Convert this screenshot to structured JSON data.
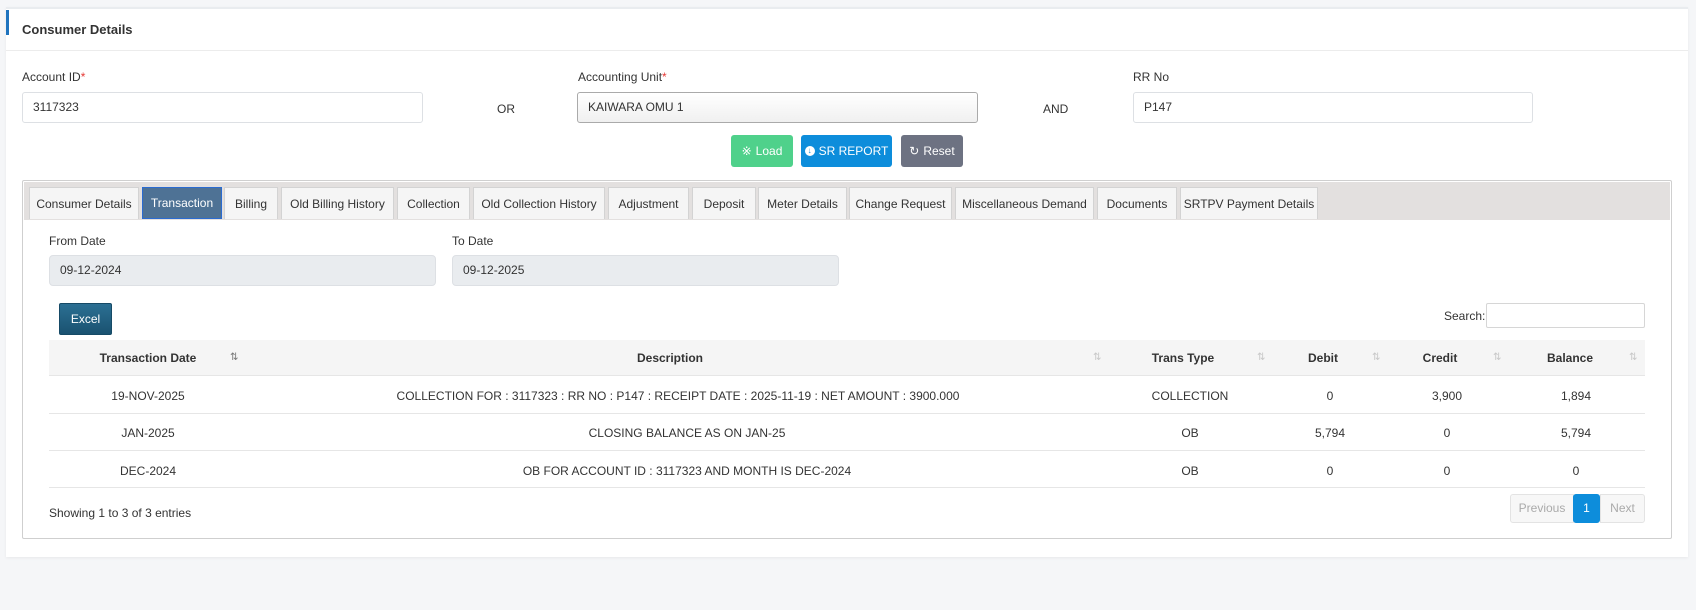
{
  "header": {
    "title": "Consumer Details"
  },
  "form": {
    "account_id_label": "Account ID",
    "account_id_value": "3117323",
    "required_mark": "*",
    "or_label": "OR",
    "accounting_unit_label": "Accounting Unit",
    "accounting_unit_value": "KAIWARA OMU 1",
    "and_label": "AND",
    "rr_no_label": "RR No",
    "rr_no_value": "P147"
  },
  "buttons": {
    "load": "Load",
    "sr_report": "SR REPORT",
    "reset": "Reset"
  },
  "tabs": [
    "Consumer Details",
    "Transaction",
    "Billing",
    "Old Billing History",
    "Collection",
    "Old Collection History",
    "Adjustment",
    "Deposit",
    "Meter Details",
    "Change Request",
    "Miscellaneous Demand",
    "Documents",
    "SRTPV Payment Details"
  ],
  "active_tab": "Transaction",
  "dates": {
    "from_label": "From Date",
    "from_value": "09-12-2024",
    "to_label": "To Date",
    "to_value": "09-12-2025"
  },
  "table": {
    "excel_label": "Excel",
    "search_label": "Search:",
    "search_value": "",
    "columns": [
      "Transaction Date",
      "Description",
      "Trans Type",
      "Debit",
      "Credit",
      "Balance"
    ],
    "rows": [
      [
        "19-NOV-2025",
        "COLLECTION FOR : 3117323 : RR NO : P147 : RECEIPT DATE : 2025-11-19 : NET AMOUNT : 3900.000",
        "COLLECTION",
        "0",
        "3,900",
        "1,894"
      ],
      [
        "JAN-2025",
        "CLOSING BALANCE AS ON JAN-25",
        "OB",
        "5,794",
        "0",
        "5,794"
      ],
      [
        "DEC-2024",
        "OB FOR ACCOUNT ID : 3117323 AND MONTH IS DEC-2024",
        "OB",
        "0",
        "0",
        "0"
      ]
    ],
    "info": "Showing 1 to 3 of 3 entries",
    "pagination": {
      "previous": "Previous",
      "current": "1",
      "next": "Next"
    }
  },
  "colors": {
    "accent": "#1e73be",
    "load": "#4fd18b",
    "sr": "#0d8ddb",
    "reset": "#6c757d",
    "tab_active": "#4e7295",
    "excel": "#1f5f7f",
    "page_active": "#0d8ddb"
  }
}
